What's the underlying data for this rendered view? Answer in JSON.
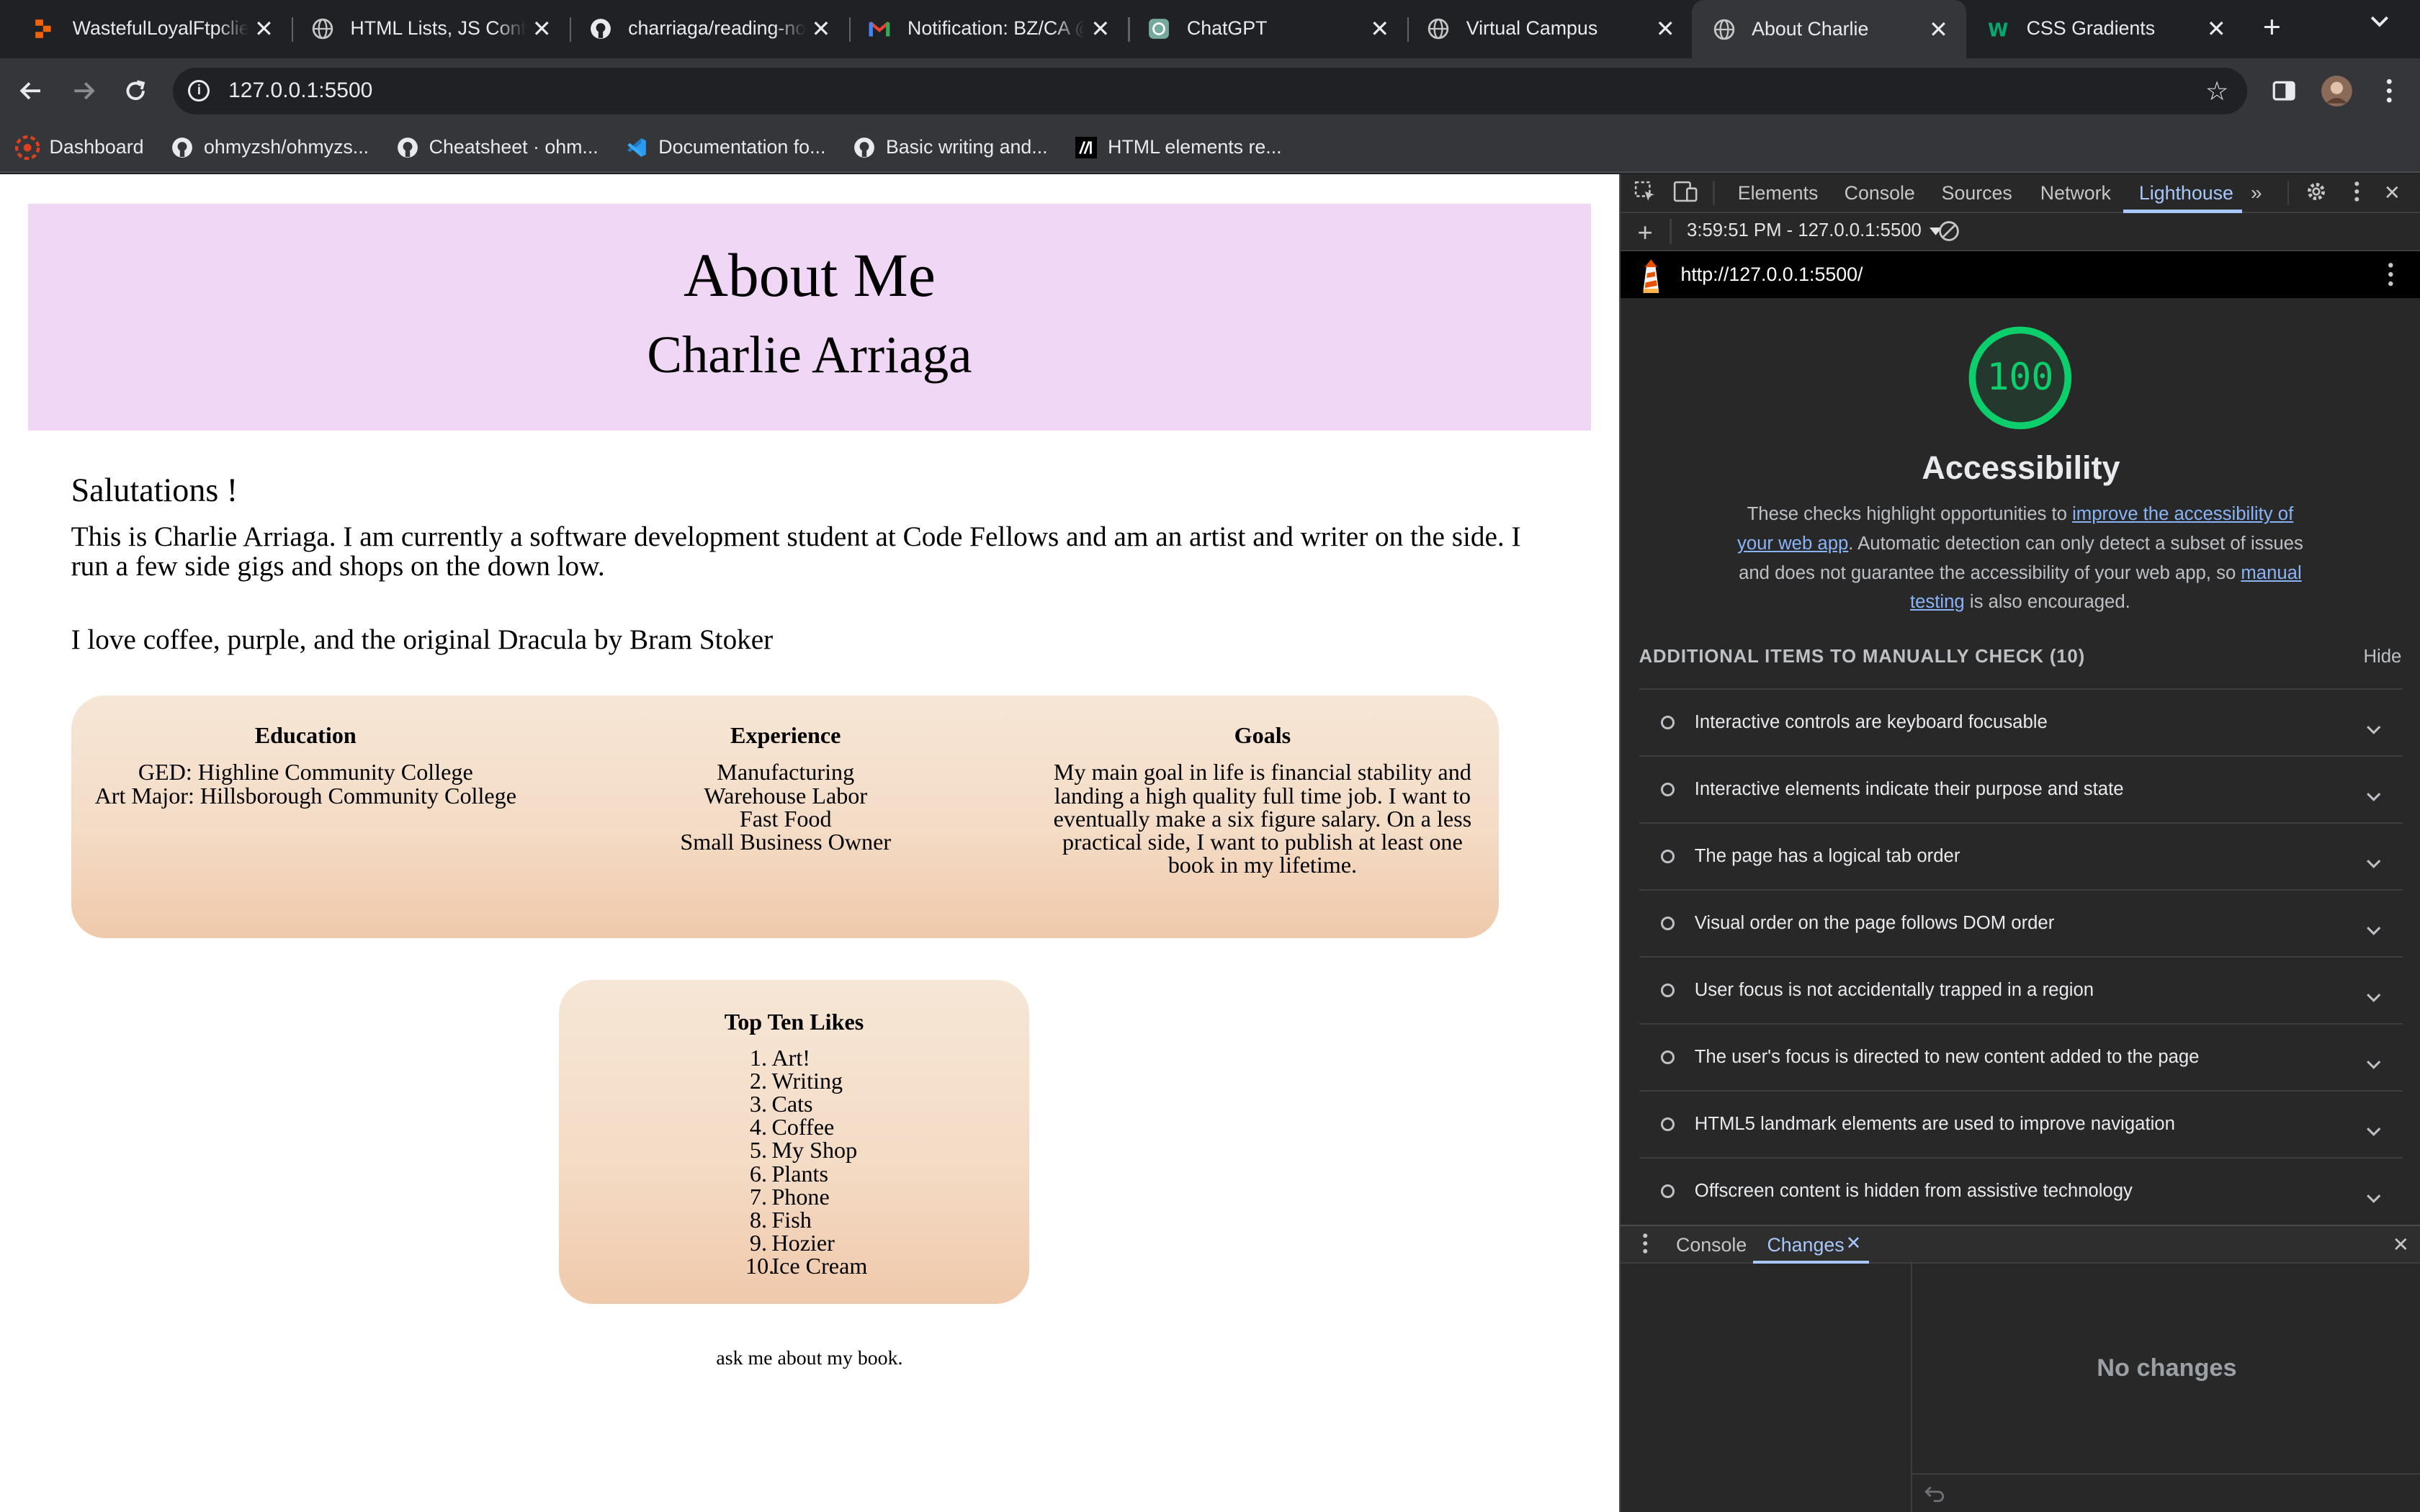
{
  "browser": {
    "tabs": [
      {
        "title": "WastefulLoyalFtpclient",
        "icon": "replit-icon"
      },
      {
        "title": "HTML Lists, JS Control",
        "icon": "globe-icon"
      },
      {
        "title": "charriaga/reading-notes",
        "icon": "github-icon"
      },
      {
        "title": "Notification: BZ/CA @",
        "icon": "gmail-icon"
      },
      {
        "title": "ChatGPT",
        "icon": "chatgpt-icon"
      },
      {
        "title": "Virtual Campus",
        "icon": "globe-icon"
      },
      {
        "title": "About Charlie",
        "icon": "globe-icon",
        "active": true
      },
      {
        "title": "CSS Gradients",
        "icon": "w3schools-icon"
      }
    ],
    "url": "127.0.0.1:5500",
    "bookmarks": [
      {
        "label": "Dashboard",
        "icon": "canvas-icon"
      },
      {
        "label": "ohmyzsh/ohmyzs...",
        "icon": "github-icon"
      },
      {
        "label": "Cheatsheet · ohm...",
        "icon": "github-icon"
      },
      {
        "label": "Documentation fo...",
        "icon": "vscode-icon"
      },
      {
        "label": "Basic writing and...",
        "icon": "github-icon"
      },
      {
        "label": "HTML elements re...",
        "icon": "mdn-icon"
      }
    ]
  },
  "page": {
    "title": "About Me",
    "name": "Charlie Arriaga",
    "greeting": "Salutations !",
    "intro": "This is Charlie Arriaga. I am currently a software development student at Code Fellows and am an artist and writer on the side. I run a few side gigs and shops on the down low.",
    "loves": "I love coffee, purple, and the original Dracula by Bram Stoker",
    "education": {
      "heading": "Education",
      "lines": [
        "GED: Highline Community College",
        "Art Major: Hillsborough Community College"
      ]
    },
    "experience": {
      "heading": "Experience",
      "lines": [
        "Manufacturing",
        "Warehouse Labor",
        "Fast Food",
        "Small Business Owner"
      ]
    },
    "goals": {
      "heading": "Goals",
      "text": "My main goal in life is financial stability and landing a high quality full time job. I want to eventually make a six figure salary. On a less practical side, I want to publish at least one book in my lifetime."
    },
    "likes": {
      "heading": "Top Ten Likes",
      "items": [
        "Art!",
        "Writing",
        "Cats",
        "Coffee",
        "My Shop",
        "Plants",
        "Phone",
        "Fish",
        "Hozier",
        "Ice Cream"
      ]
    },
    "footer": "ask me about my book."
  },
  "devtools": {
    "tabs": [
      "Elements",
      "Console",
      "Sources",
      "Network",
      "Lighthouse"
    ],
    "active_tab": "Lighthouse",
    "report_time": "3:59:51 PM - 127.0.0.1:5500",
    "report_url": "http://127.0.0.1:5500/",
    "score": "100",
    "score_color": "#0cce6b",
    "category": "Accessibility",
    "desc_before": "These checks highlight opportunities to ",
    "desc_link1": "improve the accessibility of your web app",
    "desc_middle": ". Automatic detection can only detect a subset of issues and does not guarantee the accessibility of your web app, so ",
    "desc_link2": "manual testing",
    "desc_after": " is also encouraged.",
    "manual_header": "ADDITIONAL ITEMS TO MANUALLY CHECK (10)",
    "hide_label": "Hide",
    "manual_items": [
      "Interactive controls are keyboard focusable",
      "Interactive elements indicate their purpose and state",
      "The page has a logical tab order",
      "Visual order on the page follows DOM order",
      "User focus is not accidentally trapped in a region",
      "The user's focus is directed to new content added to the page",
      "HTML5 landmark elements are used to improve navigation",
      "Offscreen content is hidden from assistive technology"
    ],
    "drawer_tabs": [
      "Console",
      "Changes"
    ],
    "drawer_active": "Changes",
    "no_changes": "No changes"
  }
}
